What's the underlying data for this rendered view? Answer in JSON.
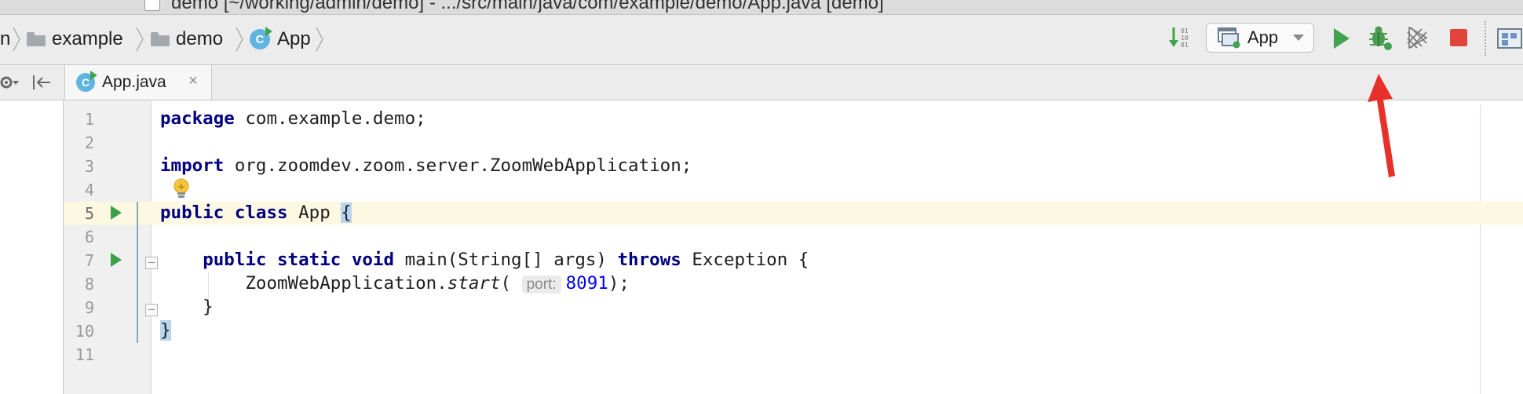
{
  "window": {
    "title": "demo [~/working/admin/demo] - .../src/main/java/com/example/demo/App.java [demo]"
  },
  "breadcrumb": {
    "items": [
      {
        "label": "n",
        "icon": "none"
      },
      {
        "label": "example",
        "icon": "folder-icon"
      },
      {
        "label": "demo",
        "icon": "folder-icon"
      },
      {
        "label": "App",
        "icon": "java-class-icon"
      }
    ]
  },
  "toolbar": {
    "run_config_label": "App",
    "icons": [
      "sort-binary-icon",
      "run-config-icon",
      "run-icon",
      "debug-icon",
      "coverage-icon",
      "stop-icon",
      "project-structure-icon"
    ],
    "run_color": "#3fa34d",
    "stop_color": "#e0453b"
  },
  "editor_tabs": [
    {
      "label": "App.java",
      "active": true
    }
  ],
  "editor": {
    "line_numbers": [
      "1",
      "2",
      "3",
      "4",
      "5",
      "6",
      "7",
      "8",
      "9",
      "10",
      "11"
    ],
    "code": {
      "l1_kw": "package",
      "l1_rest": " com.example.demo;",
      "l3_kw": "import",
      "l3_rest": " org.zoomdev.zoom.server.ZoomWebApplication;",
      "l5_kw": "public class",
      "l5_name": " App ",
      "l5_brace": "{",
      "l7_indent": "    ",
      "l7_kw": "public static void",
      "l7_mid": " main(String[] args) ",
      "l7_kw2": "throws",
      "l7_rest": " Exception {",
      "l8_indent": "        ",
      "l8_class": "ZoomWebApplication.",
      "l8_method": "start",
      "l8_paren": "( ",
      "l8_hint": "port:",
      "l8_value": "8091",
      "l8_end": ");",
      "l9": "    }",
      "l10_brace": "}"
    },
    "caret_line": 5,
    "run_markers_lines": [
      5,
      7
    ],
    "intention_bulb_line": 4
  },
  "annotation": {
    "arrow_color": "#e8302a",
    "points_to": "debug-icon"
  }
}
